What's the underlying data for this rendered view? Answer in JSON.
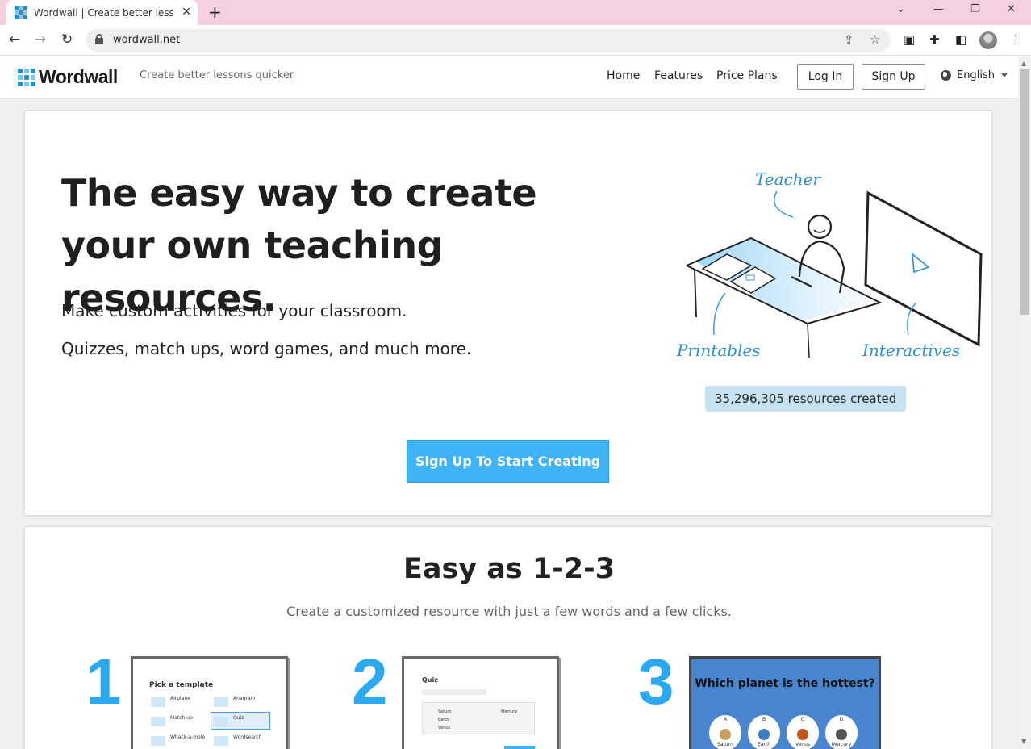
{
  "browser": {
    "tab_title": "Wordwall | Create better lessons",
    "url": "wordwall.net"
  },
  "header": {
    "logo_text": "Wordwall",
    "tagline": "Create better lessons quicker",
    "nav": {
      "home": "Home",
      "features": "Features",
      "pricing": "Price Plans"
    },
    "login": "Log In",
    "signup": "Sign Up",
    "language": "English"
  },
  "hero": {
    "title": "The easy way to create your own teaching resources.",
    "line1": "Make custom activities for your classroom.",
    "line2": "Quizzes, match ups, word games, and much more.",
    "illustration": {
      "teacher": "Teacher",
      "printables": "Printables",
      "interactives": "Interactives"
    },
    "resources_count": "35,296,305 resources created",
    "cta": "Sign Up To Start Creating"
  },
  "steps": {
    "title": "Easy as 1-2-3",
    "subtitle": "Create a customized resource with just a few words and a few clicks.",
    "numbers": [
      "1",
      "2",
      "3"
    ],
    "step1": {
      "heading": "Pick a template",
      "items": [
        "Airplane",
        "Anagram",
        "Match up",
        "Quiz",
        "Whack-a-mole",
        "Wordsearch"
      ]
    },
    "step2": {
      "heading": "Quiz",
      "options": [
        "Saturn",
        "Earth",
        "Venus",
        "Mercury"
      ]
    },
    "step3": {
      "question": "Which planet is the hottest?",
      "answers": [
        {
          "letter": "A",
          "name": "Saturn"
        },
        {
          "letter": "B",
          "name": "Earth"
        },
        {
          "letter": "C",
          "name": "Venus"
        },
        {
          "letter": "D",
          "name": "Mercury"
        }
      ]
    }
  },
  "colors": {
    "brand_blue": "#1e90d8",
    "cta_blue": "#3fb3f7",
    "tab_bar_pink": "#f6cfe0",
    "badge_blue": "#c6e1ef"
  }
}
